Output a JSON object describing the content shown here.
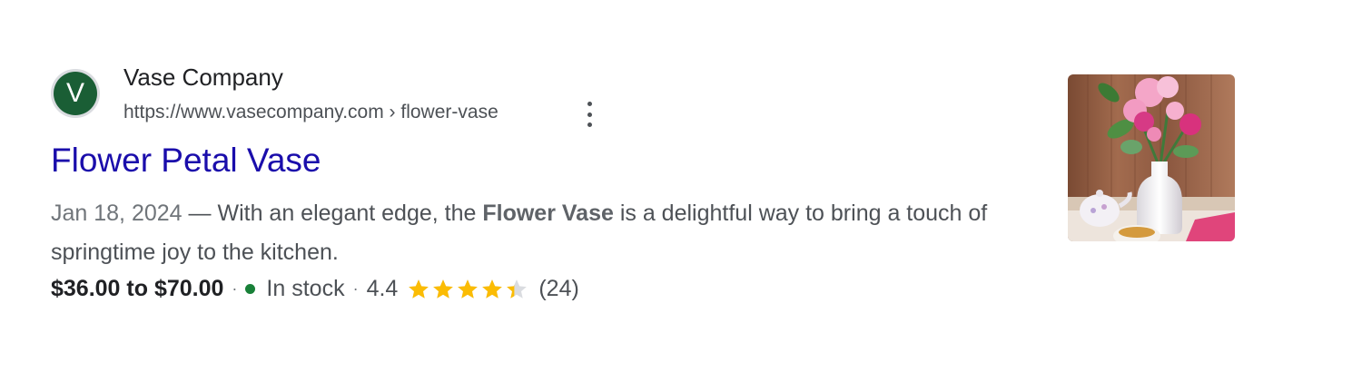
{
  "result": {
    "favicon_letter": "V",
    "site_name": "Vase Company",
    "site_url": "https://www.vasecompany.com › flower-vase",
    "title": "Flower Petal Vase",
    "snippet": {
      "date": "Jan 18, 2024",
      "dash": " — ",
      "text_before": "With an elegant edge, the ",
      "bold": "Flower Vase",
      "text_after": " is a delightful way to bring a touch of springtime joy to the kitchen."
    },
    "meta": {
      "price": "$36.00 to $70.00",
      "separator": "·",
      "stock": "In stock",
      "rating": "4.4",
      "rating_value": 4.4,
      "rating_max": 5,
      "review_count": "(24)"
    },
    "thumbnail_icon": "flower-vase-photo",
    "more_icon": "more-vert-icon"
  },
  "colors": {
    "title_link": "#1a0dab",
    "favicon_bg": "#1a5e35",
    "stock_dot": "#188038",
    "star": "#fbbc04",
    "star_empty": "#dadce0"
  }
}
